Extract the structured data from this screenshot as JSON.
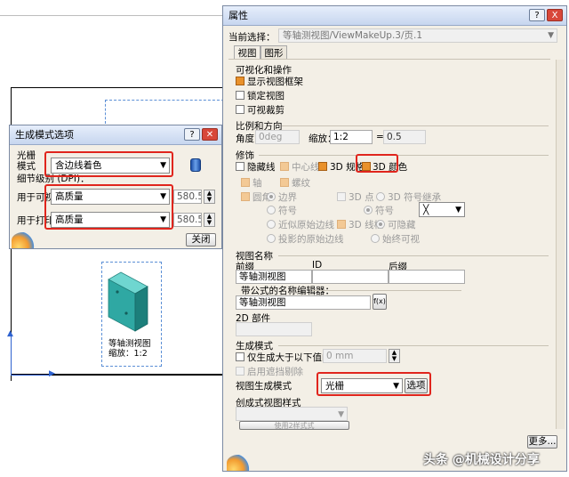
{
  "background": {
    "block_label_lines": [
      "等轴测视图",
      "缩放：1:2"
    ]
  },
  "gen_dialog": {
    "title": "生成模式选项",
    "raster_label": "光栅",
    "mode_label": "模式",
    "mode_value": "含边线着色",
    "detail_label": "细节级别 (DPI)：",
    "visual_label": "用于可视化",
    "visual_quality": "高质量",
    "visual_dpi": "580.57",
    "print_label": "用于打印",
    "print_quality": "高质量",
    "print_dpi": "580.57",
    "close_label": "关闭"
  },
  "props": {
    "title": "属性",
    "help_btn": "?",
    "close_btn": "X",
    "current_label": "当前选择：",
    "current_value": "等轴测视图/ViewMakeUp.3/页.1",
    "tabs": [
      "视图",
      "图形"
    ],
    "vis_section": "可视化和操作",
    "show_frame": "显示视图框架",
    "lock_view": "锁定视图",
    "visual_clip": "可视裁剪",
    "scale_section": "比例和方向",
    "angle_label": "角度：",
    "angle_value": "0deg",
    "scale_label": "缩放：",
    "scale_value": "1:2",
    "equals": "=",
    "scale_result": "0.5",
    "dress_section": "修饰",
    "hidden_lines": "隐藏线",
    "center_lines": "中心线",
    "spec_3d": "3D 规格",
    "color_3d": "3D 颜色",
    "axis": "轴",
    "thread": "螺纹",
    "fillet": "圆角",
    "boundary": "边界",
    "points_3d": "3D 点",
    "sym_inherit": "3D 符号继承",
    "symbol": "符号",
    "symbol2": "符号",
    "approx_orig": "近似原始边线",
    "wireframe_3d": "3D 线框",
    "hidden_opt": "可隐藏",
    "projected_orig": "投影的原始边线",
    "always_visible": "始终可视",
    "symbol_combo": "╳",
    "viewname_section": "视图名称",
    "prefix_label": "前缀",
    "id_label": "ID",
    "suffix_label": "后缀",
    "prefix_value": "等轴测视图",
    "formula_label": "带公式的名称编辑器：",
    "formula_value": "等轴测视图",
    "fx_label": "f(x)",
    "part_2d_label": "2D 部件",
    "gen_section": "生成模式",
    "only_larger": "仅生成大于以下值的零件",
    "threshold": "0 mm",
    "occlusion": "启用遮挡剔除",
    "gen_mode_label": "视图生成模式",
    "gen_mode_value": "光栅",
    "options_btn": "选项",
    "style_label": "创成式视图样式",
    "style_btn": "使用2样式式",
    "more_btn": "更多..."
  },
  "watermark": "头条 @机械设计分享"
}
